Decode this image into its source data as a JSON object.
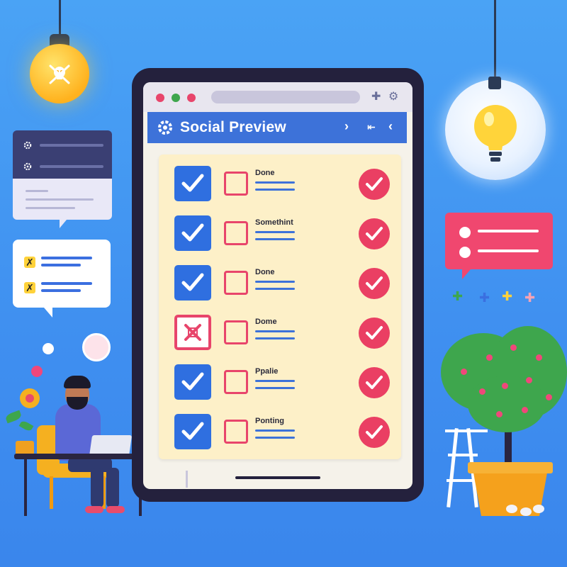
{
  "app": {
    "title": "Social Preview",
    "header_icons": [
      "chevron-right-icon",
      "collapse-icon",
      "back-icon"
    ]
  },
  "browser": {
    "window_controls": [
      "close",
      "minimize",
      "maximize"
    ],
    "toolbar_icons": [
      "add-tab-icon",
      "settings-icon"
    ]
  },
  "tasks": [
    {
      "label": "Done",
      "state": "checked"
    },
    {
      "label": "Somethint",
      "state": "checked"
    },
    {
      "label": "Done",
      "state": "checked"
    },
    {
      "label": "Dome",
      "state": "failed"
    },
    {
      "label": "Ppalie",
      "state": "checked"
    },
    {
      "label": "Ponting",
      "state": "checked"
    }
  ],
  "colors": {
    "background": "#4aa3f5",
    "header": "#3d72d9",
    "accent_red": "#ea3f63",
    "checkbox_blue": "#2f6fe0",
    "panel": "#fdf0c8",
    "tablet_frame": "#24213d"
  }
}
